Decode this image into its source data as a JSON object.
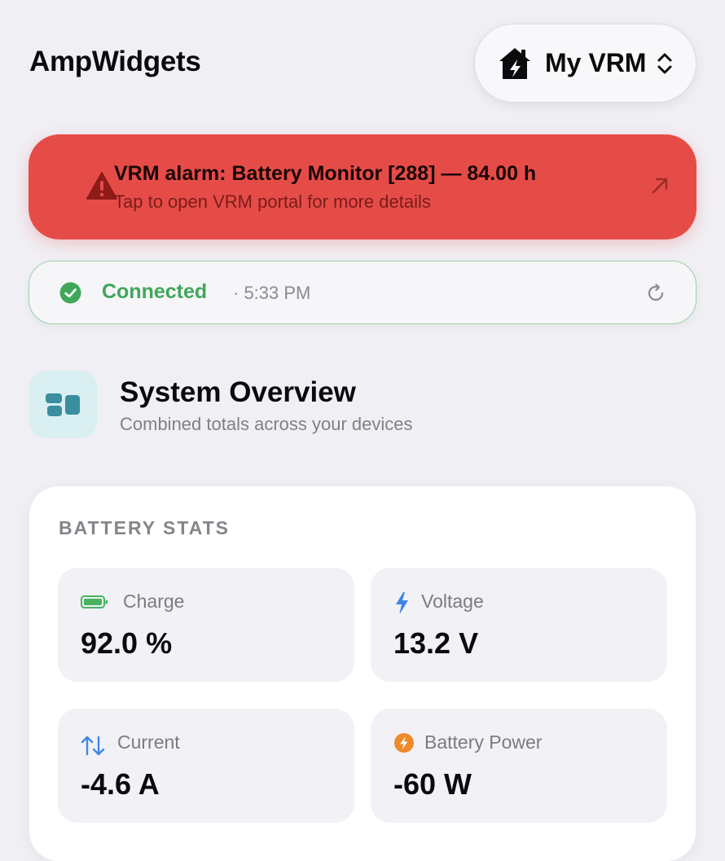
{
  "header": {
    "app_title": "AmpWidgets",
    "vrm_picker_label": "My VRM"
  },
  "alarm": {
    "title": "VRM alarm: Battery Monitor [288] — 84.00 h",
    "subtitle": "Tap to open VRM portal for more details",
    "color": "#e64c47"
  },
  "connection": {
    "status": "Connected",
    "time": "· 5:33 PM",
    "color": "#3fa75a"
  },
  "overview": {
    "title": "System Overview",
    "subtitle": "Combined totals across your devices"
  },
  "battery_stats": {
    "title": "BATTERY STATS",
    "tiles": [
      {
        "label": "Charge",
        "value": "92.0 %",
        "icon": "battery-icon"
      },
      {
        "label": "Voltage",
        "value": "13.2 V",
        "icon": "bolt-icon"
      },
      {
        "label": "Current",
        "value": "-4.6 A",
        "icon": "up-down-arrows-icon"
      },
      {
        "label": "Battery Power",
        "value": "-60 W",
        "icon": "power-bolt-circle-icon"
      }
    ]
  }
}
